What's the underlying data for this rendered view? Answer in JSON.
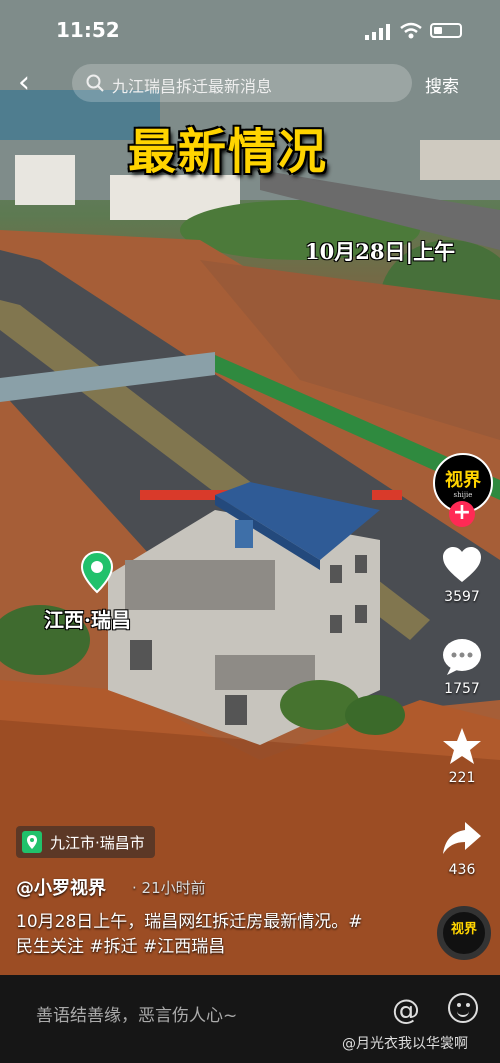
{
  "status_bar": {
    "time": "11:52"
  },
  "search": {
    "query": "九江瑞昌拆迁最新消息",
    "button": "搜索"
  },
  "video": {
    "headline": "最新情况",
    "date_caption": "10月28日|上午",
    "place_caption": "江西·瑞昌"
  },
  "side_rail": {
    "avatar_text": "视界",
    "avatar_sub": "shijie",
    "likes": "3597",
    "comments": "1757",
    "favorites": "221",
    "shares": "436"
  },
  "post": {
    "location": "九江市·瑞昌市",
    "author": "@小罗视界",
    "time_ago": "· 21小时前",
    "description": "10月28日上午，瑞昌网红拆迁房最新情况。#民生关注 #拆迁 #江西瑞昌",
    "disc_text": "视界"
  },
  "bottom_bar": {
    "comment_placeholder": "善语结善缘，恶言伤人心~",
    "watermark": "@月光衣我以华裳啊"
  },
  "colors": {
    "headline": "#ffd400",
    "follow": "#ff2a55",
    "location_pin": "#21c16b"
  },
  "icons": [
    "back-icon",
    "search-icon",
    "heart-icon",
    "comment-icon",
    "star-icon",
    "share-icon",
    "at-icon",
    "emoji-icon",
    "location-pin-icon"
  ]
}
